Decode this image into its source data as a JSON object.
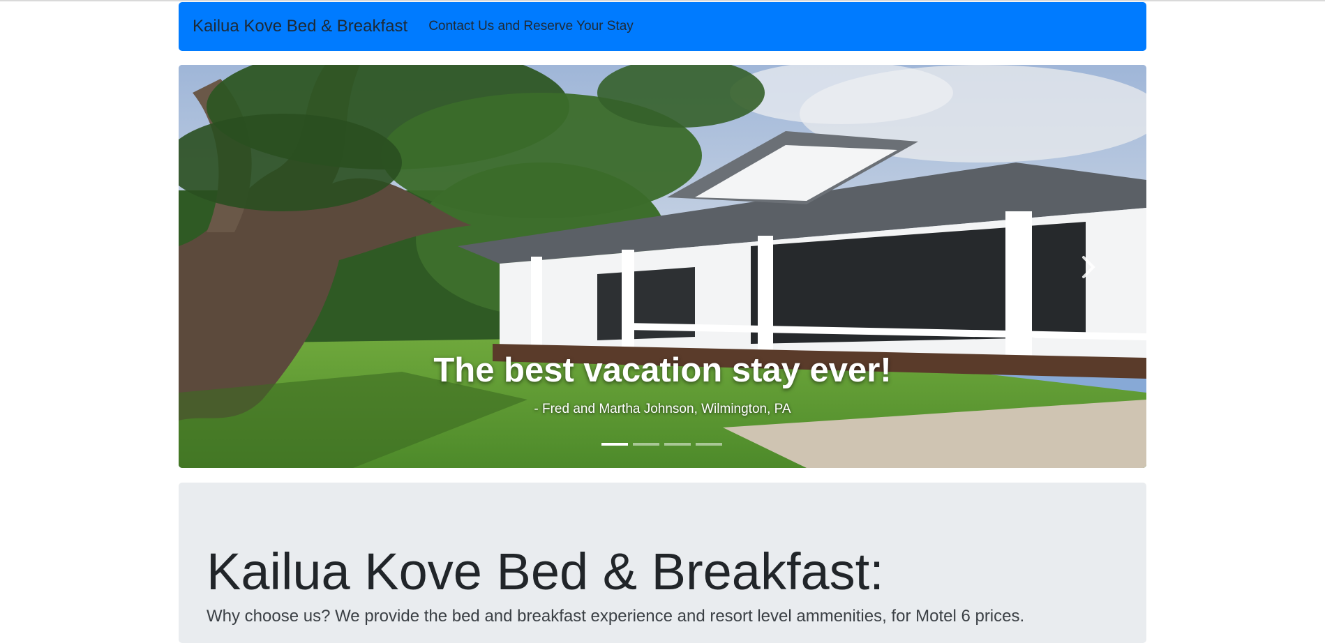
{
  "navbar": {
    "brand": "Kailua Kove Bed & Breakfast",
    "contact_link": "Contact Us and Reserve Your Stay",
    "bg_color": "#007bff"
  },
  "carousel": {
    "caption_title": "The best vacation stay ever!",
    "caption_subtitle": "- Fred and Martha Johnson, Wilmington, PA",
    "slide_count": 4,
    "active_slide": 1,
    "next_icon": "chevron-right-icon"
  },
  "jumbotron": {
    "title": "Kailua Kove Bed & Breakfast:",
    "lead": "Why choose us? We provide the bed and breakfast experience and resort level ammenities, for Motel 6 prices.",
    "bg_color": "#e9ecef"
  }
}
